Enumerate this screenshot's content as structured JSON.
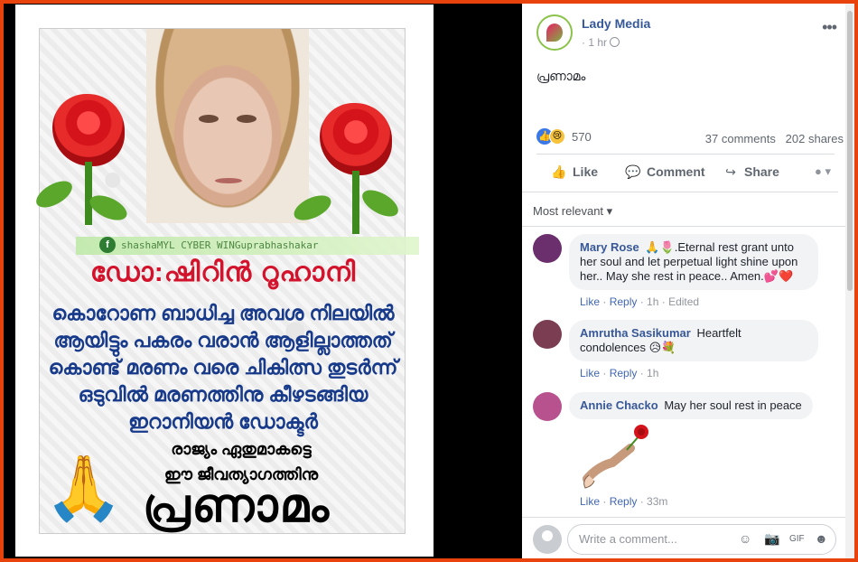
{
  "poster": {
    "watermark": "shashaMYL CYBER WINGuprabhashakar",
    "title": "ഡോ:ഷിറിൻ റൂഹാനി",
    "body_lines": [
      "കൊറോണ ബാധിച്ച അവശ നിലയിൽ",
      "ആയിട്ടും പകരം വരാൻ ആളില്ലാത്തത്",
      "കൊണ്ട് മരണം വരെ ചികിത്സ തുടർന്ന്",
      "ഒടുവിൽ മരണത്തിനു കീഴടങ്ങിയ",
      "ഇറാനിയൻ ഡോക്ടർ"
    ],
    "small_lines": [
      "രാജ്യം ഏതുമാകട്ടെ",
      "ഈ ജീവത്യാഗത്തിനു"
    ],
    "big_word": "പ്രണാമം",
    "hands_emoji": "🙏"
  },
  "post": {
    "page_name": "Lady Media",
    "time": "1 hr",
    "more": "•••",
    "text": "പ്രണാമം",
    "reaction_count": "570",
    "comments_count": "37 comments",
    "shares_count": "202 shares"
  },
  "actions": {
    "like": "Like",
    "comment": "Comment",
    "share": "Share",
    "audience": "▾"
  },
  "sort_label": "Most relevant ▾",
  "comments": [
    {
      "name": "Mary Rose",
      "text": "🙏🌷.Eternal rest grant unto her soul and let perpetual light shine upon her.. May she rest in peace.. Amen.💕❤️",
      "like": "Like",
      "reply": "Reply",
      "time": "1h",
      "extra": "Edited",
      "avatar_color": "#6b2f6d"
    },
    {
      "name": "Amrutha Sasikumar",
      "text": "Heartfelt condolences 😥💐",
      "like": "Like",
      "reply": "Reply",
      "time": "1h",
      "avatar_color": "#7a3d52"
    },
    {
      "name": "Annie Chacko",
      "text": "May her soul rest in peace",
      "like": "Like",
      "reply": "Reply",
      "time": "33m",
      "avatar_color": "#b8528f"
    }
  ],
  "compose": {
    "placeholder": "Write a comment..."
  },
  "colors": {
    "border": "#e8430d",
    "link": "#365899",
    "poster_title": "#d3132b",
    "poster_body": "#173a8a"
  }
}
